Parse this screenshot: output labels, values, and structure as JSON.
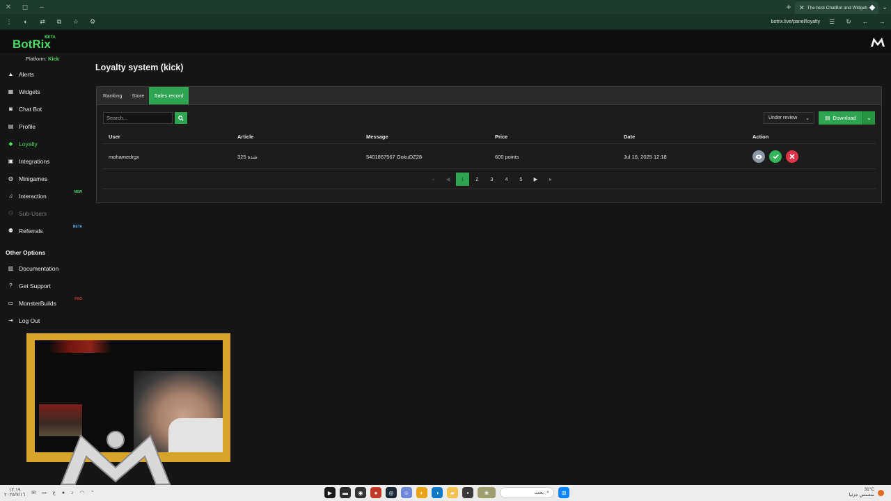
{
  "browser": {
    "tab_title": "The best ChatBot and Widgets",
    "url": "botrix.live/panel/loyalty"
  },
  "brand": {
    "name": "BotRix",
    "beta": "BETA"
  },
  "sidebar": {
    "platform_label": "Platform:",
    "platform_value": "Kick",
    "items": [
      {
        "label": "Alerts",
        "icon": "warning-icon"
      },
      {
        "label": "Widgets",
        "icon": "grid-icon"
      },
      {
        "label": "Chat Bot",
        "icon": "robot-icon"
      },
      {
        "label": "Profile",
        "icon": "id-card-icon"
      },
      {
        "label": "Loyalty",
        "icon": "gem-icon",
        "active": true
      },
      {
        "label": "Integrations",
        "icon": "puzzle-icon"
      },
      {
        "label": "Minigames",
        "icon": "gamepad-icon"
      },
      {
        "label": "Interaction",
        "icon": "music-icon",
        "badge": "NEW"
      },
      {
        "label": "Sub-Users",
        "icon": "users-icon",
        "disabled": true
      },
      {
        "label": "Referrals",
        "icon": "people-icon",
        "badge": "BETA"
      }
    ],
    "other_title": "Other Options",
    "other_items": [
      {
        "label": "Documentation",
        "icon": "book-icon"
      },
      {
        "label": "Get Support",
        "icon": "question-icon"
      },
      {
        "label": "MonsterBuilds",
        "icon": "monitor-icon",
        "badge": "PRO"
      },
      {
        "label": "Log Out",
        "icon": "logout-icon"
      }
    ]
  },
  "main": {
    "title": "Loyalty system (kick)",
    "tabs": [
      "Ranking",
      "Store",
      "Sales record"
    ],
    "active_tab": "Sales record",
    "search_placeholder": "Search...",
    "status_filter": "Under review",
    "download_label": "Download",
    "columns": [
      "User",
      "Article",
      "Message",
      "Price",
      "Date",
      "Action"
    ],
    "rows": [
      {
        "user": "mohamedrgx",
        "article": "325 شدة",
        "message": "5401867567 GokuDZ28",
        "price": "600 points",
        "date": "Jul 16, 2025 12:18"
      }
    ],
    "pagination": {
      "current": "1",
      "pages": [
        "2",
        "3",
        "4",
        "5"
      ]
    }
  },
  "taskbar": {
    "search_text": "بحث",
    "temperature": "31°C",
    "weather": "مشمس جزئيا",
    "time": "١٢:١٩",
    "date": "٢٠٢٥/٧/١٦",
    "lang": "ع"
  },
  "colors": {
    "accent": "#2fa552",
    "brand": "#4cd964",
    "danger": "#e0344a",
    "webcam_frame": "#d7a52b"
  }
}
